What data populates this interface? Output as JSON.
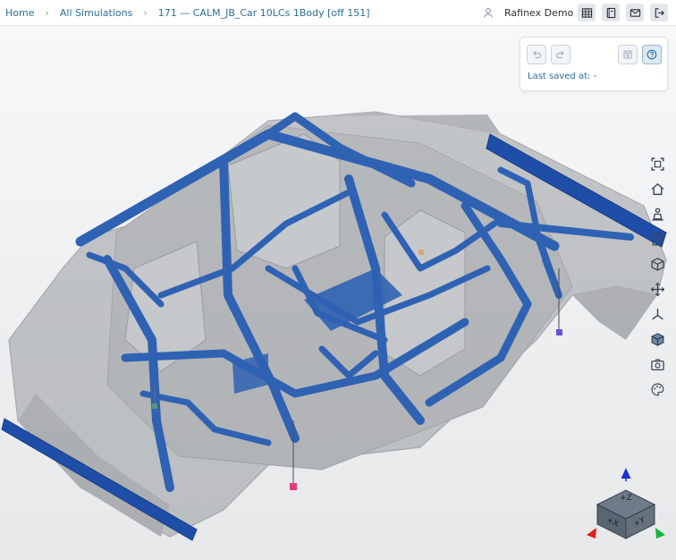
{
  "breadcrumb": {
    "home": "Home",
    "all_simulations": "All Simulations",
    "current": "171 — CALM_JB_Car 10LCs 1Body [off 151]"
  },
  "user": {
    "name": "Rafinex Demo",
    "icon": "user-icon"
  },
  "header_buttons": [
    {
      "name": "table-grid-icon"
    },
    {
      "name": "notebook-icon"
    },
    {
      "name": "mail-icon"
    },
    {
      "name": "logout-icon"
    }
  ],
  "save_panel": {
    "last_saved": "Last saved at: -",
    "buttons": [
      "undo-icon",
      "redo-icon",
      "save-disk-icon",
      "help-icon"
    ]
  },
  "toolbar": [
    "fit-view-icon",
    "home-view-icon",
    "visibility-icon",
    "clipboard-icon",
    "cube-icon",
    "move-icon",
    "axes-icon",
    "solid-cube-icon",
    "camera-icon",
    "palette-icon"
  ],
  "view_cube": {
    "z_label": "+Z",
    "x_label": "+X",
    "y_label": "+Y"
  },
  "colors": {
    "accent": "#2d6f9a",
    "structure_blue": "#2f62b3",
    "body_gray": "#8c8f93",
    "load_magenta": "#e23a7c",
    "load_purple": "#6a4fd8",
    "axis_z": "#1f2fd6",
    "axis_x": "#e11d1d",
    "axis_y": "#14b43a"
  }
}
